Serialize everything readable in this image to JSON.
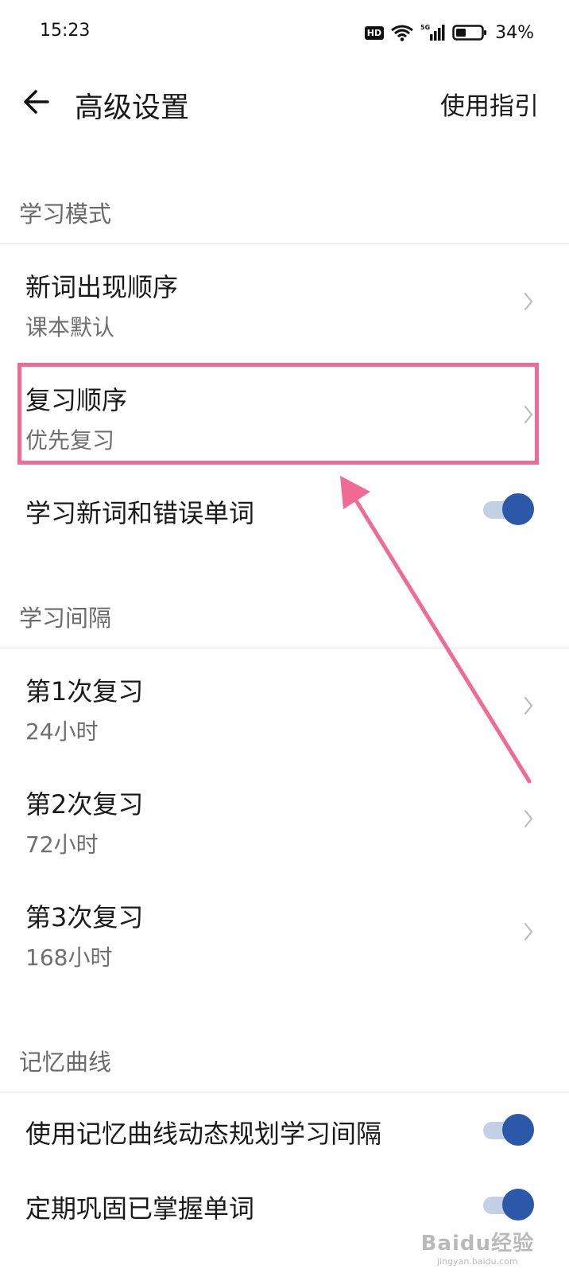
{
  "status_bar": {
    "time": "15:23",
    "hd": "HD",
    "signal": "5G",
    "battery": "34%"
  },
  "header": {
    "title": "高级设置",
    "guide": "使用指引"
  },
  "sections": {
    "learning_mode": {
      "label": "学习模式",
      "new_word_order": {
        "title": "新词出现顺序",
        "value": "课本默认"
      },
      "review_order": {
        "title": "复习顺序",
        "value": "优先复习"
      },
      "new_and_wrong": {
        "title": "学习新词和错误单词",
        "enabled": true
      }
    },
    "interval": {
      "label": "学习间隔",
      "items": [
        {
          "title": "第1次复习",
          "value": "24小时"
        },
        {
          "title": "第2次复习",
          "value": "72小时"
        },
        {
          "title": "第3次复习",
          "value": "168小时"
        }
      ]
    },
    "memory_curve": {
      "label": "记忆曲线",
      "dynamic_plan": {
        "title": "使用记忆曲线动态规划学习间隔",
        "enabled": true
      },
      "consolidate": {
        "title": "定期巩固已掌握单词",
        "enabled": true
      }
    }
  },
  "annotation": {
    "color": "#ef6b94"
  },
  "watermark": {
    "brand": "Baidu经验",
    "url": "jingyan.baidu.com"
  },
  "colors": {
    "toggle_on": "#2b58a8",
    "toggle_track": "#c4d0e6"
  }
}
